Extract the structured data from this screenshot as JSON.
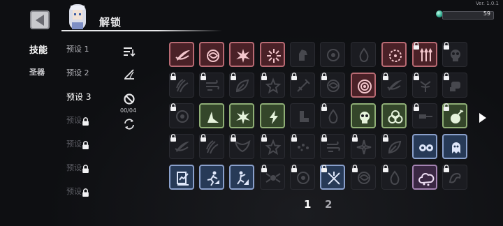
{
  "header": {
    "title": "解锁",
    "version": "Ver. 1.0.1",
    "resource_value": "59"
  },
  "tabs": [
    {
      "label": "技能"
    },
    {
      "label": "圣器"
    }
  ],
  "presets": [
    {
      "label": "预设 1",
      "locked": false
    },
    {
      "label": "预设 2",
      "locked": false
    },
    {
      "label": "预设 3",
      "locked": false,
      "active": true
    },
    {
      "label": "预设",
      "locked": true
    },
    {
      "label": "预设",
      "locked": true
    },
    {
      "label": "预设",
      "locked": true
    },
    {
      "label": "预设",
      "locked": true
    }
  ],
  "tools": {
    "counter": "00/04",
    "icons": [
      "sort-icon",
      "slope-icon",
      "no-icon",
      "refresh-icon"
    ]
  },
  "pagination": {
    "pages": [
      "1",
      "2"
    ],
    "current": "1"
  },
  "colors": {
    "red": "#b86a73",
    "green": "#8fae76",
    "blue": "#8aa0cb",
    "purple": "#a483b2",
    "gem": "#2aa58a"
  },
  "grid": [
    [
      {
        "r": "red",
        "l": false,
        "i": "slash"
      },
      {
        "r": "red",
        "l": false,
        "i": "swirl"
      },
      {
        "r": "red",
        "l": false,
        "i": "burst"
      },
      {
        "r": "red",
        "l": false,
        "i": "spark"
      },
      {
        "r": "dark",
        "l": false,
        "i": "horse"
      },
      {
        "r": "dark",
        "l": false,
        "i": "ring"
      },
      {
        "r": "dark",
        "l": false,
        "i": "drop"
      },
      {
        "r": "red",
        "l": false,
        "i": "circle"
      },
      {
        "r": "red",
        "l": true,
        "i": "arrows"
      },
      {
        "r": "dark",
        "l": true,
        "i": "skull"
      }
    ],
    [
      {
        "r": "dark",
        "l": true,
        "i": "claw"
      },
      {
        "r": "dark",
        "l": true,
        "i": "wind"
      },
      {
        "r": "dark",
        "l": true,
        "i": "leaf"
      },
      {
        "r": "dark",
        "l": true,
        "i": "star"
      },
      {
        "r": "dark",
        "l": true,
        "i": "sword"
      },
      {
        "r": "dark",
        "l": true,
        "i": "swirl"
      },
      {
        "r": "red",
        "l": false,
        "i": "target"
      },
      {
        "r": "dark",
        "l": true,
        "i": "slash"
      },
      {
        "r": "dark",
        "l": true,
        "i": "tree"
      },
      {
        "r": "dark",
        "l": true,
        "i": "gauntlet"
      }
    ],
    [
      {
        "r": "dark",
        "l": true,
        "i": "ring"
      },
      {
        "r": "green",
        "l": false,
        "i": "fin"
      },
      {
        "r": "green",
        "l": false,
        "i": "burst"
      },
      {
        "r": "green",
        "l": false,
        "i": "bolt"
      },
      {
        "r": "dark",
        "l": false,
        "i": "boot"
      },
      {
        "r": "dark",
        "l": true,
        "i": "drop"
      },
      {
        "r": "green",
        "l": false,
        "i": "skull"
      },
      {
        "r": "green",
        "l": false,
        "i": "biohazard"
      },
      {
        "r": "dark",
        "l": true,
        "i": "hammer"
      },
      {
        "r": "green",
        "l": true,
        "i": "bomb"
      }
    ],
    [
      {
        "r": "dark",
        "l": true,
        "i": "slash"
      },
      {
        "r": "dark",
        "l": true,
        "i": "claw"
      },
      {
        "r": "dark",
        "l": true,
        "i": "wing"
      },
      {
        "r": "dark",
        "l": true,
        "i": "star"
      },
      {
        "r": "dark",
        "l": true,
        "i": "dots"
      },
      {
        "r": "dark",
        "l": true,
        "i": "wind"
      },
      {
        "r": "dark",
        "l": true,
        "i": "shuriken"
      },
      {
        "r": "dark",
        "l": true,
        "i": "leaf"
      },
      {
        "r": "blue",
        "l": false,
        "i": "face"
      },
      {
        "r": "blue",
        "l": false,
        "i": "ghost"
      }
    ],
    [
      {
        "r": "blue",
        "l": false,
        "i": "chart"
      },
      {
        "r": "blue",
        "l": false,
        "i": "runner"
      },
      {
        "r": "blue",
        "l": false,
        "i": "runner2"
      },
      {
        "r": "dark",
        "l": true,
        "i": "spider"
      },
      {
        "r": "dark",
        "l": true,
        "i": "ring"
      },
      {
        "r": "blue",
        "l": true,
        "i": "cross"
      },
      {
        "r": "dark",
        "l": true,
        "i": "swirl"
      },
      {
        "r": "dark",
        "l": true,
        "i": "drop"
      },
      {
        "r": "purple",
        "l": false,
        "i": "cloud"
      },
      {
        "r": "dark",
        "l": true,
        "i": "dragon"
      }
    ]
  ]
}
